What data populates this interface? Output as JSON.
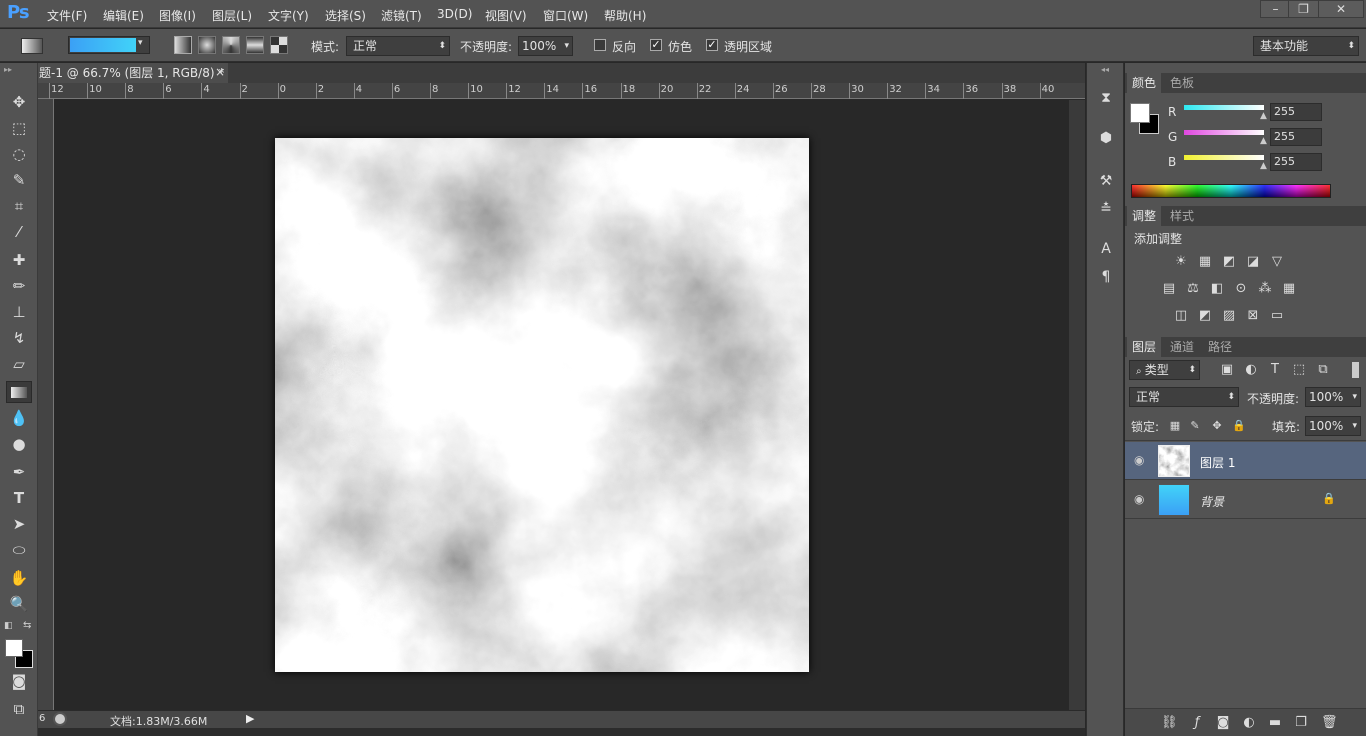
{
  "menubar": {
    "logo": "Ps",
    "items": [
      "文件(F)",
      "编辑(E)",
      "图像(I)",
      "图层(L)",
      "文字(Y)",
      "选择(S)",
      "滤镜(T)",
      "3D(D)",
      "视图(V)",
      "窗口(W)",
      "帮助(H)"
    ],
    "window_controls": [
      "–",
      "❐",
      "✕"
    ]
  },
  "options": {
    "mode_label": "模式:",
    "mode_value": "正常",
    "opacity_label": "不透明度:",
    "opacity_value": "100%",
    "reverse_label": "反向",
    "dither_label": "仿色",
    "transparency_label": "透明区域",
    "workspace": "基本功能",
    "gradient_colors": [
      "#3ba0f5",
      "#41d3f8"
    ]
  },
  "document": {
    "tab_title": "题-1 @ 66.7% (图层 1, RGB/8) *",
    "tab_close": "×",
    "ruler_labels": [
      "12",
      "10",
      "8",
      "6",
      "4",
      "2",
      "0",
      "2",
      "4",
      "6",
      "8",
      "10",
      "12",
      "14",
      "16",
      "18",
      "20",
      "22",
      "24",
      "26",
      "28",
      "30",
      "32",
      "34",
      "36",
      "38",
      "40"
    ],
    "status": "文档:1.83M/3.66M",
    "zoom": "6"
  },
  "color_panel": {
    "tabs": [
      "颜色",
      "色板"
    ],
    "channels": [
      {
        "label": "R",
        "value": "255",
        "color": "#2ee8f0"
      },
      {
        "label": "G",
        "value": "255",
        "color": "#e048e0"
      },
      {
        "label": "B",
        "value": "255",
        "color": "#f0f030"
      }
    ]
  },
  "adjust_panel": {
    "tabs": [
      "调整",
      "样式"
    ],
    "title": "添加调整"
  },
  "layers_panel": {
    "tabs": [
      "图层",
      "通道",
      "路径"
    ],
    "filter_type": "类型",
    "blend_mode": "正常",
    "opacity_label": "不透明度:",
    "opacity_value": "100%",
    "lock_label": "锁定:",
    "fill_label": "填充:",
    "fill_value": "100%",
    "layers": [
      {
        "name": "图层 1",
        "selected": true
      },
      {
        "name": "背景",
        "selected": false,
        "locked": true
      }
    ]
  },
  "colors": {
    "accent_blue": "#3aa6f3",
    "layer_selected": "#56657e"
  }
}
